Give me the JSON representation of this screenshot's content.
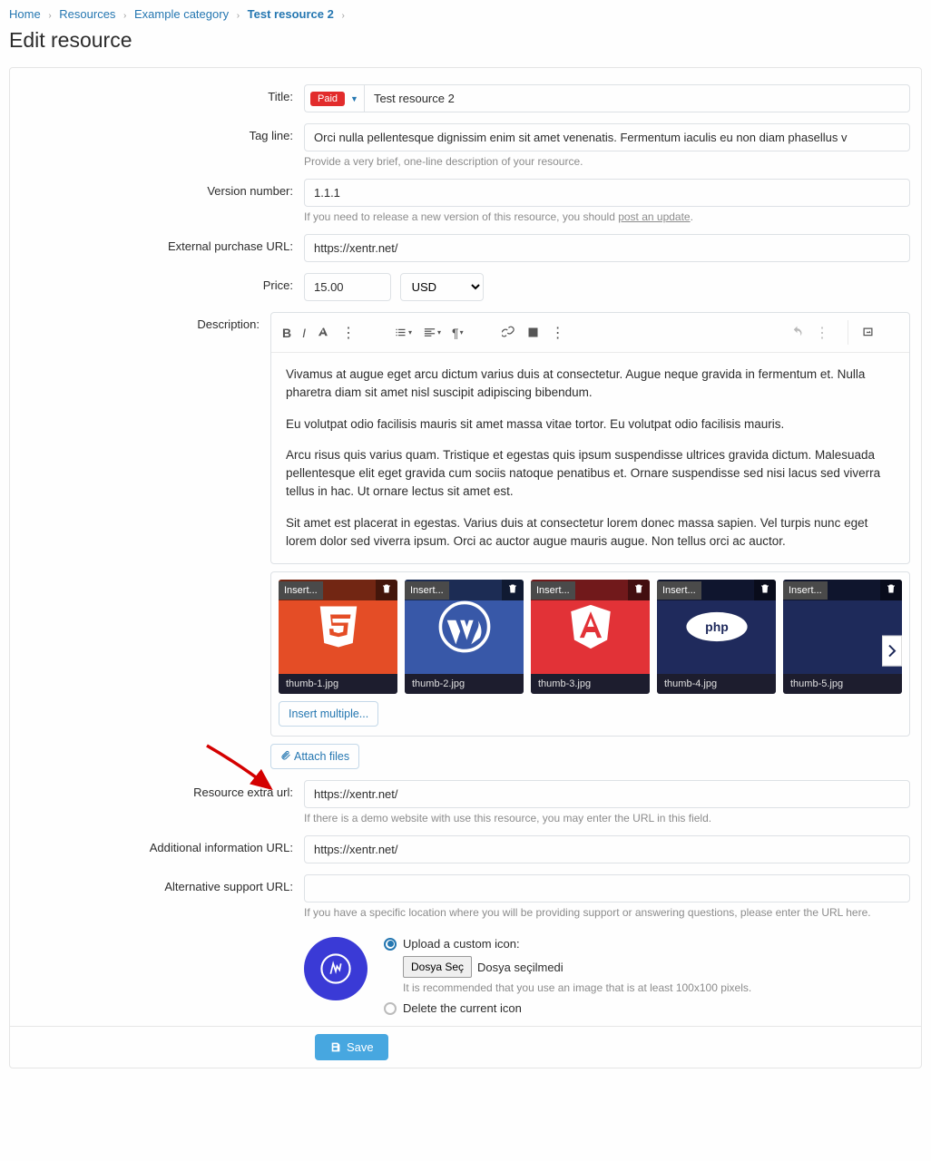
{
  "breadcrumb": {
    "items": [
      "Home",
      "Resources",
      "Example category"
    ],
    "current": "Test resource 2"
  },
  "page_title": "Edit resource",
  "labels": {
    "title": "Title:",
    "tagline": "Tag line:",
    "version": "Version number:",
    "purchase_url": "External purchase URL:",
    "price": "Price:",
    "description": "Description:",
    "extra_url": "Resource extra url:",
    "additional_url": "Additional information URL:",
    "support_url": "Alternative support URL:"
  },
  "prefix": {
    "label": "Paid"
  },
  "fields": {
    "title": "Test resource 2",
    "tagline": "Orci nulla pellentesque dignissim enim sit amet venenatis. Fermentum iaculis eu non diam phasellus v",
    "tagline_hint": "Provide a very brief, one-line description of your resource.",
    "version": "1.1.1",
    "version_hint": "If you need to release a new version of this resource, you should ",
    "version_hint_link": "post an update",
    "purchase_url": "https://xentr.net/",
    "price": "15.00",
    "currency": "USD",
    "extra_url": "https://xentr.net/",
    "extra_url_hint": "If there is a demo website with use this resource, you may enter the URL in this field.",
    "additional_url": "https://xentr.net/",
    "support_url": "",
    "support_url_hint": "If you have a specific location where you will be providing support or answering questions, please enter the URL here."
  },
  "description": {
    "p1": "Vivamus at augue eget arcu dictum varius duis at consectetur. Augue neque gravida in fermentum et. Nulla pharetra diam sit amet nisl suscipit adipiscing bibendum.",
    "p2": "Eu volutpat odio facilisis mauris sit amet massa vitae tortor. Eu volutpat odio facilisis mauris.",
    "p3": "Arcu risus quis varius quam. Tristique et egestas quis ipsum suspendisse ultrices gravida dictum. Malesuada pellentesque elit eget gravida cum sociis natoque penatibus et. Ornare suspendisse sed nisi lacus sed viverra tellus in hac. Ut ornare lectus sit amet est.",
    "p4": "Sit amet est placerat in egestas. Varius duis at consectetur lorem donec massa sapien. Vel turpis nunc eget lorem dolor sed viverra ipsum. Orci ac auctor augue mauris augue. Non tellus orci ac auctor."
  },
  "attachments": {
    "insert_label": "Insert...",
    "items": [
      {
        "name": "thumb-1.jpg",
        "color": "#e44d26",
        "icon": "html5"
      },
      {
        "name": "thumb-2.jpg",
        "color": "#3858a8",
        "icon": "wordpress"
      },
      {
        "name": "thumb-3.jpg",
        "color": "#e23237",
        "icon": "angular"
      },
      {
        "name": "thumb-4.jpg",
        "color": "#1f2a5c",
        "icon": "php"
      },
      {
        "name": "thumb-5.jpg",
        "color": "#1e2a5a",
        "icon": "blank"
      }
    ],
    "insert_multiple": "Insert multiple...",
    "attach_files": "Attach files"
  },
  "icon_section": {
    "upload_label": "Upload a custom icon:",
    "file_button": "Dosya Seç",
    "file_status": "Dosya seçilmedi",
    "file_hint": "It is recommended that you use an image that is at least 100x100 pixels.",
    "delete_label": "Delete the current icon"
  },
  "save_label": "Save"
}
